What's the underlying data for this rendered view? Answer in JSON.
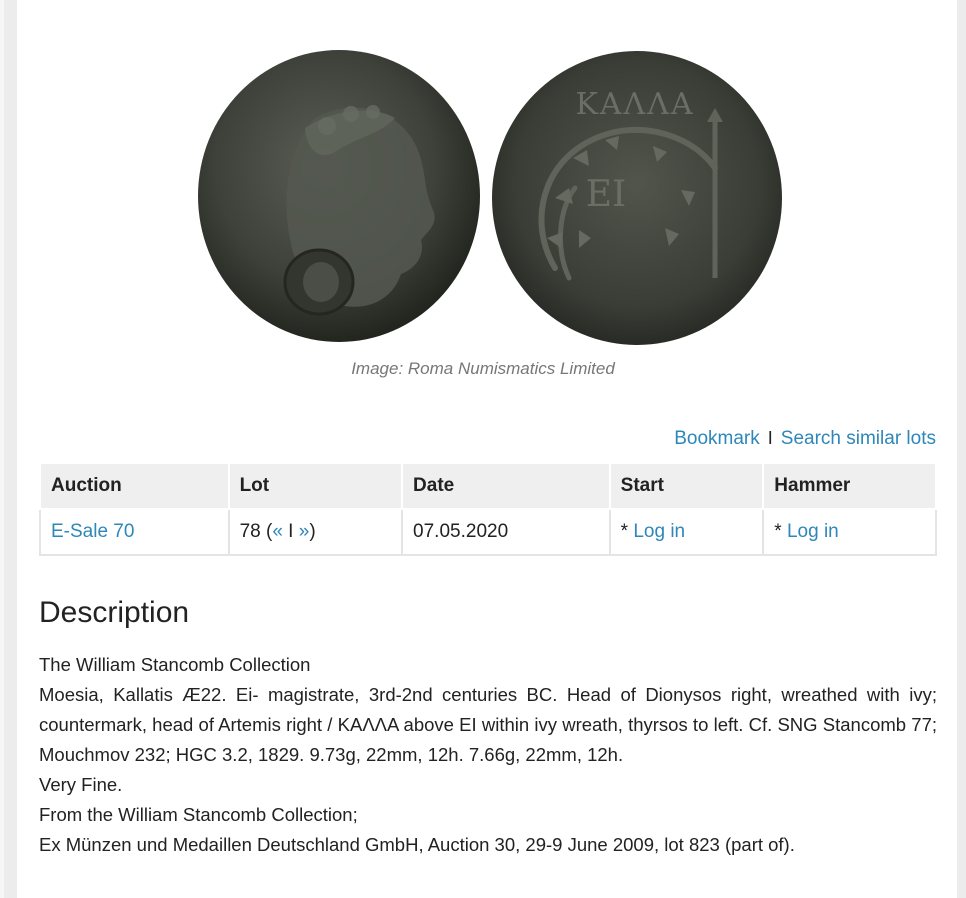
{
  "image_caption": "Image: Roma Numismatics Limited",
  "coin_reverse_text": {
    "top": "ΚΑΛΛΑ",
    "center": "ΕΙ"
  },
  "actions": {
    "bookmark_label": "Bookmark",
    "separator": "I",
    "search_similar_label": "Search similar lots"
  },
  "table": {
    "headers": [
      "Auction",
      "Lot",
      "Date",
      "Start",
      "Hammer"
    ],
    "row": {
      "auction": "E-Sale 70",
      "lot_number": "78 (",
      "lot_prev": "«",
      "lot_sep": " I ",
      "lot_next": "»",
      "lot_close": ")",
      "date": "07.05.2020",
      "start_prefix": "* ",
      "start_link": "Log in",
      "hammer_prefix": "* ",
      "hammer_link": "Log in"
    }
  },
  "description": {
    "title": "Description",
    "lines": [
      "The William Stancomb Collection",
      "Moesia, Kallatis Æ22. Ei- magistrate, 3rd-2nd centuries BC. Head of Dionysos right, wreathed with ivy; countermark, head of Artemis right / ΚΑΛΛΑ above EI within ivy wreath, thyrsos to left. Cf. SNG Stancomb 77; Mouchmov 232; HGC 3.2, 1829. 9.73g, 22mm, 12h. 7.66g, 22mm, 12h.",
      "Very Fine.",
      "From the William Stancomb Collection;",
      "Ex Münzen und Medaillen Deutschland GmbH, Auction 30, 29-9 June 2009, lot 823 (part of)."
    ]
  },
  "colors": {
    "link": "#2e87b8",
    "coin_dark": "#2f322c",
    "coin_mid": "#4d5048",
    "header_bg": "#efefef"
  }
}
